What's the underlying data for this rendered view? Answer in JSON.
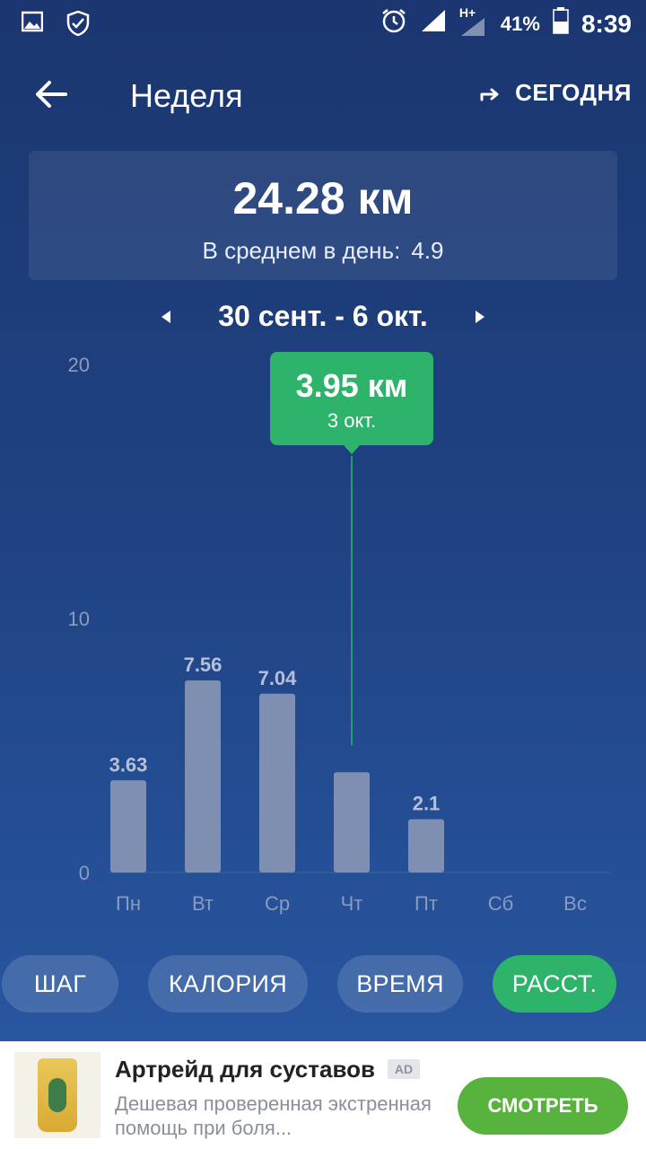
{
  "status_bar": {
    "icons": [
      "image-icon",
      "shield-check-icon",
      "alarm-icon",
      "signal-icon",
      "signal-hplus-icon",
      "battery-icon"
    ],
    "network_label": "H+",
    "battery": "41%",
    "time": "8:39"
  },
  "header": {
    "title": "Неделя",
    "today_label": "СЕГОДНЯ"
  },
  "summary": {
    "total": "24.28 км",
    "avg_label": "В среднем в день:",
    "avg_value": "4.9"
  },
  "week_range": "30 сент. - 6 окт.",
  "tooltip": {
    "value": "3.95 км",
    "date": "3 окт."
  },
  "chart_data": {
    "type": "bar",
    "categories": [
      "Пн",
      "Вт",
      "Ср",
      "Чт",
      "Пт",
      "Сб",
      "Вс"
    ],
    "values": [
      3.63,
      7.56,
      7.04,
      3.95,
      2.1,
      0,
      0
    ],
    "data_labels": [
      "3.63",
      "7.56",
      "7.04",
      "",
      "2.1",
      "",
      ""
    ],
    "y_ticks": [
      "0",
      "10",
      "20"
    ],
    "ylim": [
      0,
      20
    ],
    "selected_index": 3,
    "colors": {
      "bar": "#7f8fb2",
      "selected_line": "#2db46a",
      "tooltip": "#2db46a"
    }
  },
  "tabs": [
    {
      "label": "ШАГ",
      "active": false
    },
    {
      "label": "КАЛОРИЯ",
      "active": false
    },
    {
      "label": "ВРЕМЯ",
      "active": false
    },
    {
      "label": "РАССТ.",
      "active": true
    }
  ],
  "ad": {
    "title": "Артрейд для суставов",
    "badge": "AD",
    "description": "Дешевая проверенная экстренная помощь при боля...",
    "cta": "СМОТРЕТЬ"
  },
  "colors": {
    "accent": "#2db46a",
    "cta": "#57b33e",
    "background_top": "#1b3670",
    "background_bottom": "#2a5aa6"
  }
}
